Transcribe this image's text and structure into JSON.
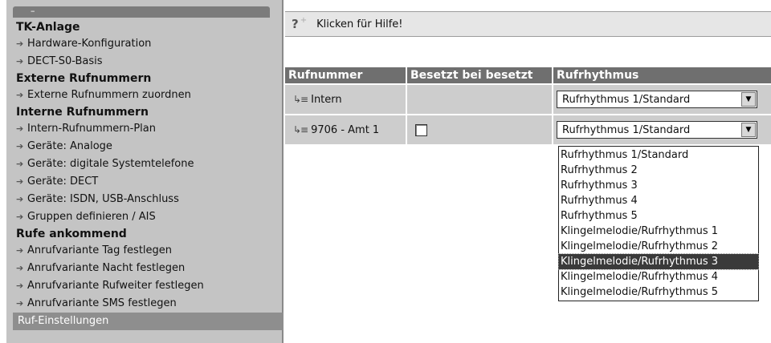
{
  "sidebar": {
    "collapse_label": "–",
    "sections": [
      {
        "title": "TK-Anlage",
        "items": [
          "Hardware-Konfiguration",
          "DECT-S0-Basis"
        ]
      },
      {
        "title": "Externe Rufnummern",
        "items": [
          "Externe Rufnummern zuordnen"
        ]
      },
      {
        "title": "Interne Rufnummern",
        "items": [
          "Intern-Rufnummern-Plan",
          "Geräte: Analoge",
          "Geräte: digitale Systemtelefone",
          "Geräte: DECT",
          "Geräte: ISDN, USB-Anschluss",
          "Gruppen definieren / AIS"
        ]
      },
      {
        "title": "Rufe ankommend",
        "items": [
          "Anrufvariante Tag festlegen",
          "Anrufvariante Nacht festlegen",
          "Anrufvariante Rufweiter festlegen",
          "Anrufvariante SMS festlegen"
        ]
      }
    ],
    "active_item": "Ruf-Einstellungen"
  },
  "help": {
    "icon": "?",
    "plus": "+",
    "text": "Klicken für Hilfe!"
  },
  "table": {
    "headers": [
      "Rufnummer",
      "Besetzt bei besetzt",
      "Rufrhythmus"
    ],
    "rows": [
      {
        "number": "Intern",
        "has_checkbox": false,
        "rhythm": "Rufrhythmus 1/Standard"
      },
      {
        "number": "9706 - Amt 1",
        "has_checkbox": true,
        "checked": false,
        "rhythm": "Rufrhythmus 1/Standard"
      }
    ]
  },
  "dropdown": {
    "options": [
      "Rufrhythmus 1/Standard",
      "Rufrhythmus 2",
      "Rufrhythmus 3",
      "Rufrhythmus 4",
      "Rufrhythmus 5",
      "Klingelmelodie/Rufrhythmus 1",
      "Klingelmelodie/Rufrhythmus 2",
      "Klingelmelodie/Rufrhythmus 3",
      "Klingelmelodie/Rufrhythmus 4",
      "Klingelmelodie/Rufrhythmus 5"
    ],
    "highlighted_index": 7
  },
  "icons": {
    "nav_arrow": "arrow-right-icon",
    "route": "phone-route-icon",
    "select_button": "triangle-down-icon",
    "help": "question-mark-icon"
  },
  "colors": {
    "sidebar_bg": "#c4c4c4",
    "header_bg": "#6f6f6f",
    "row_bg": "#cdcdcd",
    "highlight_bg": "#3a3a3a"
  }
}
